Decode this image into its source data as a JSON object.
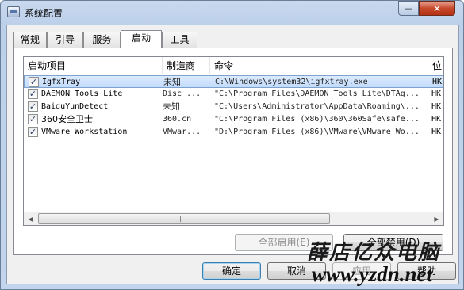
{
  "window": {
    "title": "系统配置",
    "minimize_glyph": "—",
    "close_glyph": "✕"
  },
  "tabs": [
    {
      "label": "常规"
    },
    {
      "label": "引导"
    },
    {
      "label": "服务"
    },
    {
      "label": "启动",
      "active": true
    },
    {
      "label": "工具"
    }
  ],
  "startup_list": {
    "columns": [
      "启动项目",
      "制造商",
      "命令",
      "位"
    ],
    "rows": [
      {
        "checked": true,
        "item": "IgfxTray",
        "maker": "未知",
        "command": "C:\\Windows\\system32\\igfxtray.exe",
        "location": "HK",
        "selected": true
      },
      {
        "checked": true,
        "item": "DAEMON Tools Lite",
        "maker": "Disc ...",
        "command": "\"C:\\Program Files\\DAEMON Tools Lite\\DTAg...",
        "location": "HK"
      },
      {
        "checked": true,
        "item": "BaiduYunDetect",
        "maker": "未知",
        "command": "\"C:\\Users\\Administrator\\AppData\\Roaming\\...",
        "location": "HK"
      },
      {
        "checked": true,
        "item": "360安全卫士",
        "maker": "360.cn",
        "command": "\"C:\\Program Files (x86)\\360\\360Safe\\safe...",
        "location": "HK"
      },
      {
        "checked": true,
        "item": "VMware Workstation",
        "maker": "VMwar...",
        "command": "\"D:\\Program Files (x86)\\VMware\\VMware Wo...",
        "location": "HK"
      }
    ],
    "check_glyph": "✓",
    "scroll_left_glyph": "◀",
    "scroll_right_glyph": "▶"
  },
  "buttons": {
    "enable_all": "全部启用(E)",
    "disable_all": "全部禁用(D)",
    "ok": "确定",
    "cancel": "取消",
    "apply": "应用",
    "help": "帮助"
  },
  "watermark": {
    "text_cn": "薛店亿众电脑",
    "url": "www.yzdn.net"
  }
}
